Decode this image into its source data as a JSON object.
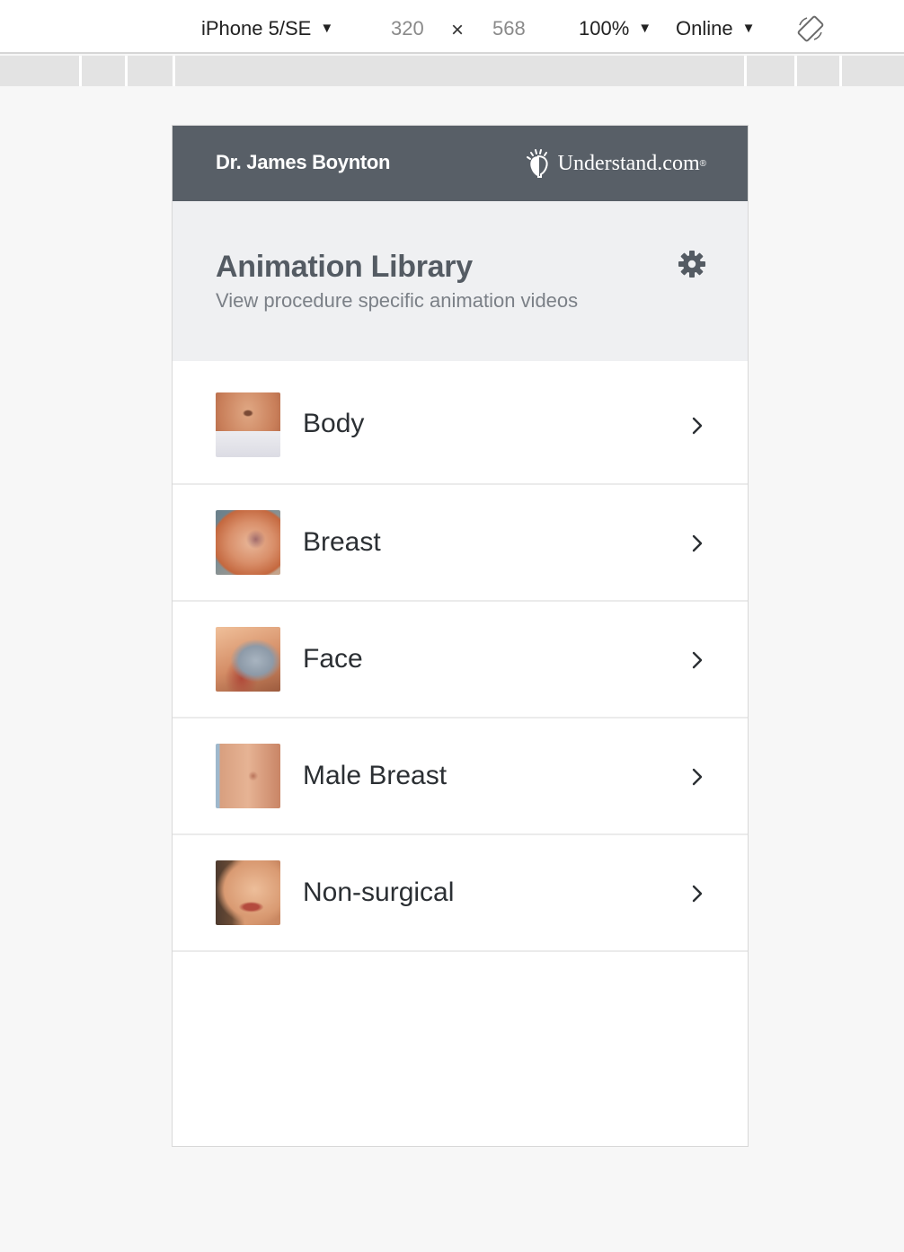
{
  "devtools": {
    "device_label": "iPhone 5/SE",
    "width_value": "320",
    "times_symbol": "×",
    "height_value": "568",
    "zoom_label": "100%",
    "network_label": "Online",
    "caret_glyph": "▼",
    "rotate_icon": "rotate-device-icon"
  },
  "header": {
    "doctor_name": "Dr. James Boynton",
    "brand_name": "Understand.com",
    "brand_mark": "®",
    "brand_icon": "understand-logo-icon",
    "background_color": "#585f67"
  },
  "hero": {
    "title": "Animation Library",
    "subtitle": "View procedure specific animation videos",
    "settings_icon": "gear-icon",
    "background_color": "#eff0f2"
  },
  "categories": [
    {
      "label": "Body",
      "thumbnail": "body-thumbnail",
      "chevron": "chevron-right-icon"
    },
    {
      "label": "Breast",
      "thumbnail": "breast-thumbnail",
      "chevron": "chevron-right-icon"
    },
    {
      "label": "Face",
      "thumbnail": "face-thumbnail",
      "chevron": "chevron-right-icon"
    },
    {
      "label": "Male Breast",
      "thumbnail": "male-breast-thumbnail",
      "chevron": "chevron-right-icon"
    },
    {
      "label": "Non-surgical",
      "thumbnail": "non-surgical-thumbnail",
      "chevron": "chevron-right-icon"
    }
  ]
}
